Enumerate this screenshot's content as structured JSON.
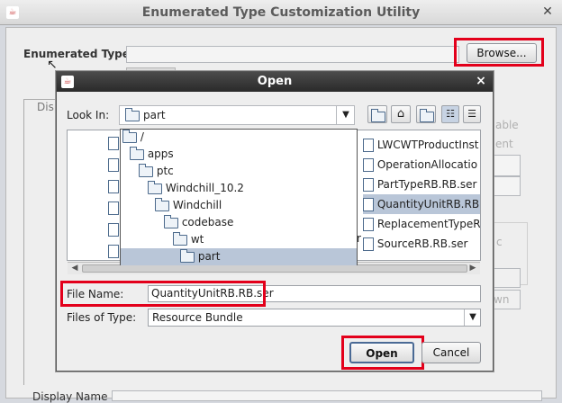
{
  "main_window": {
    "title": "Enumerated Type Customization Utility",
    "enum_label": "Enumerated Type:",
    "browse_button": "Browse...",
    "tab_partial": "Disp",
    "ghost_right_1": "able",
    "ghost_right_2": "ent",
    "ghost_right_3": "c",
    "ghost_right_4": "wn",
    "display_name_label": "Display Name"
  },
  "dialog": {
    "title": "Open",
    "look_in_label": "Look In:",
    "look_in_value": "part",
    "files_right": [
      "LWCWTProductInst",
      "OperationAllocatio",
      "PartTypeRB.RB.ser",
      "QuantityUnitRB.RB.",
      "ReplacementTypeR",
      "SourceRB.RB.ser"
    ],
    "partial_r": "r",
    "dropdown_items": [
      {
        "label": "/",
        "indent": 0
      },
      {
        "label": "apps",
        "indent": 1
      },
      {
        "label": "ptc",
        "indent": 2
      },
      {
        "label": "Windchill_10.2",
        "indent": 3
      },
      {
        "label": "Windchill",
        "indent": 4
      },
      {
        "label": "codebase",
        "indent": 5
      },
      {
        "label": "wt",
        "indent": 6
      },
      {
        "label": "part",
        "indent": 7
      }
    ],
    "file_name_label": "File Name:",
    "file_name_value": "QuantityUnitRB.RB.ser",
    "files_of_type_label": "Files of Type:",
    "files_of_type_value": "Resource Bundle",
    "open_button": "Open",
    "cancel_button": "Cancel"
  },
  "colors": {
    "highlight_box": "#e3001b",
    "dialog_titlebar": "#2f2f2f",
    "selection": "#b9c6d8"
  }
}
